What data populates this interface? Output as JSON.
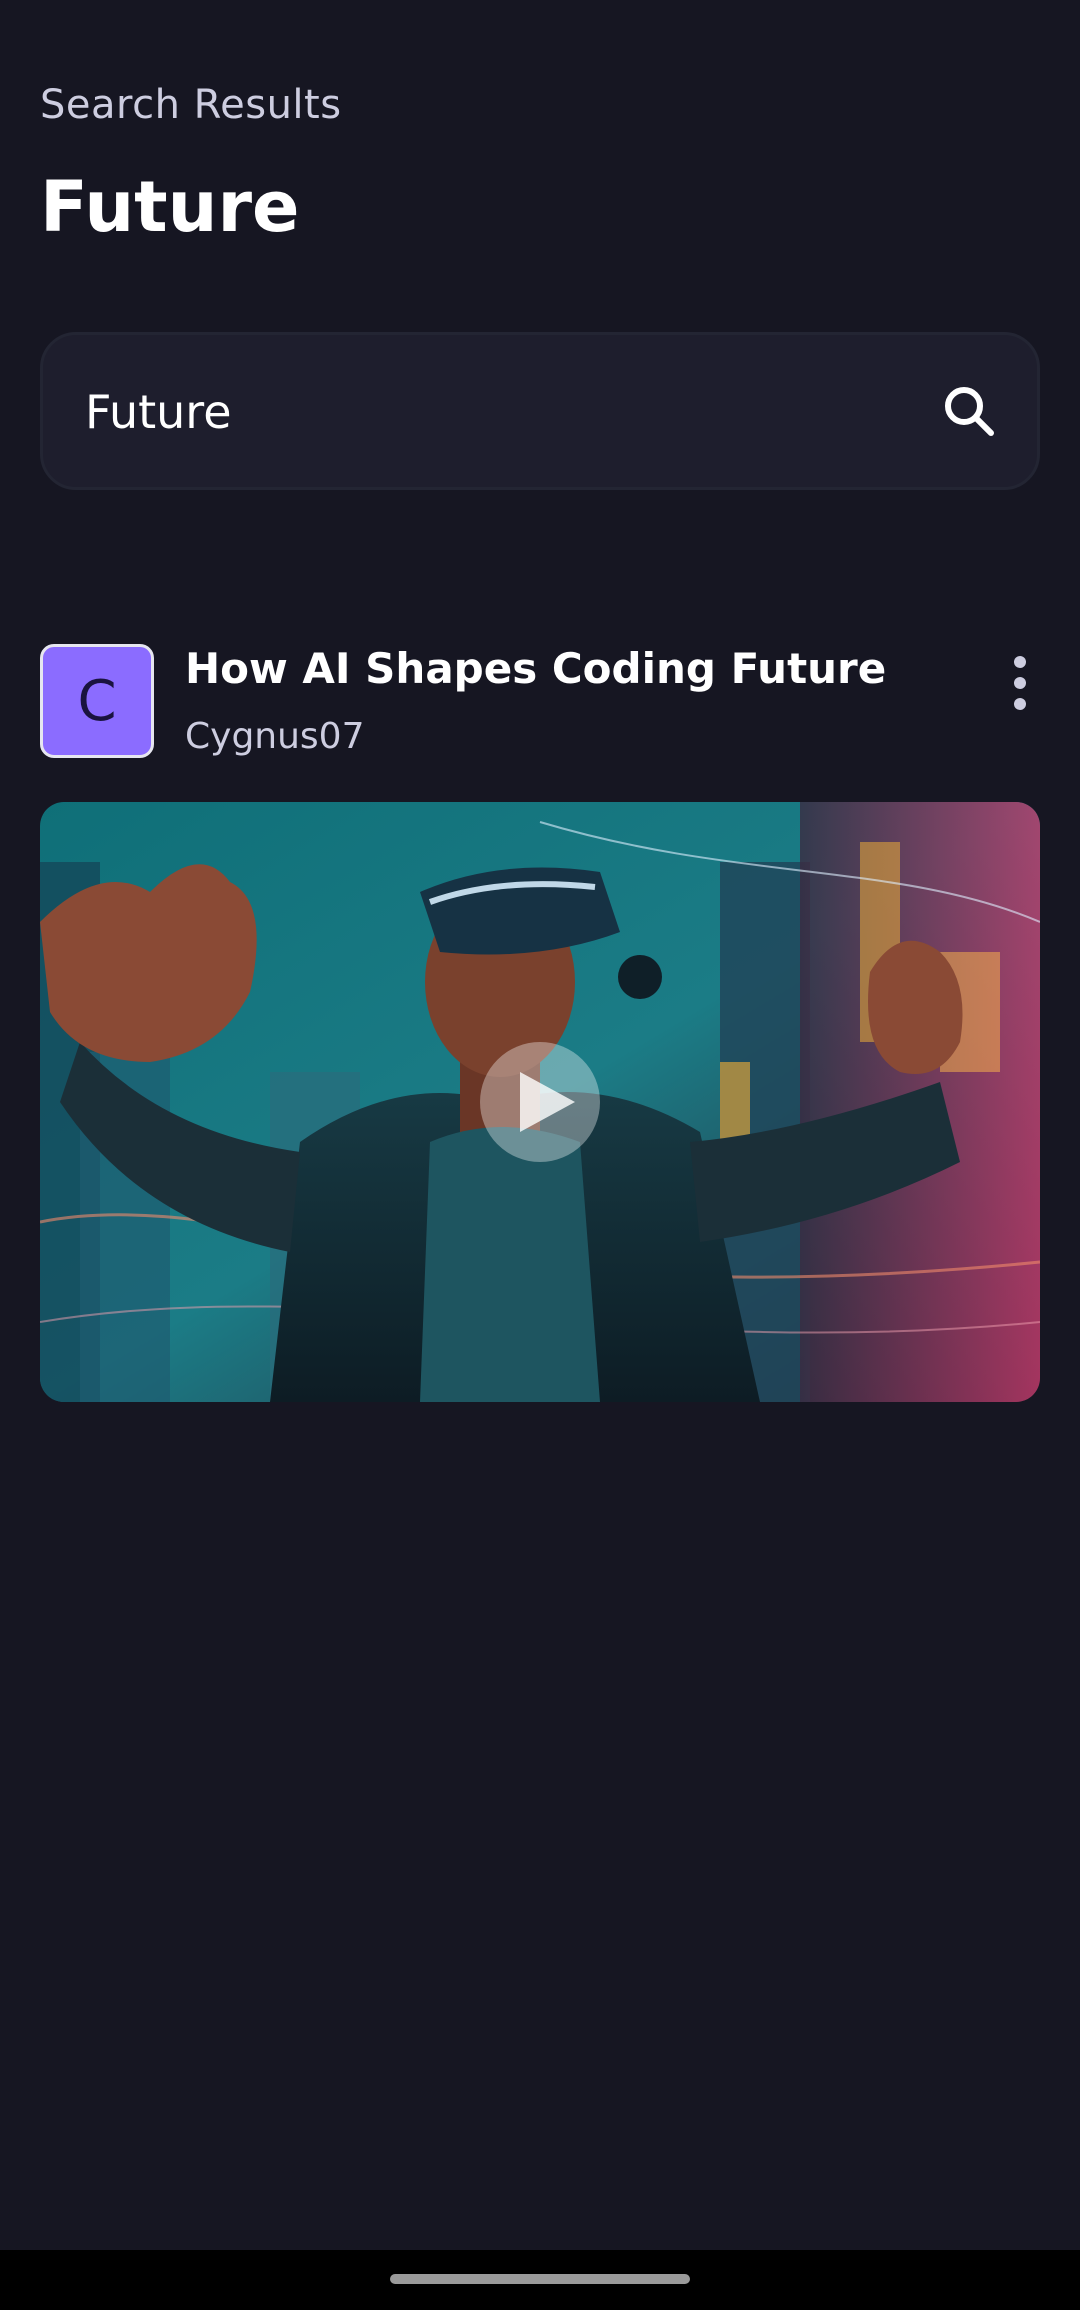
{
  "header": {
    "subtitle": "Search Results",
    "query_title": "Future"
  },
  "search": {
    "value": "Future",
    "icon": "search-icon"
  },
  "results": [
    {
      "avatar_letter": "C",
      "title": "How AI Shapes Coding Future",
      "creator": "Cygnus07",
      "menu_icon": "more-vertical-icon",
      "thumbnail": "vr-headset-person-city-image",
      "play_icon": "play-icon"
    }
  ],
  "colors": {
    "background": "#161622",
    "search_bg": "#1e1e2d",
    "avatar": "#8b6cff",
    "secondary_text": "#cdcde0"
  }
}
